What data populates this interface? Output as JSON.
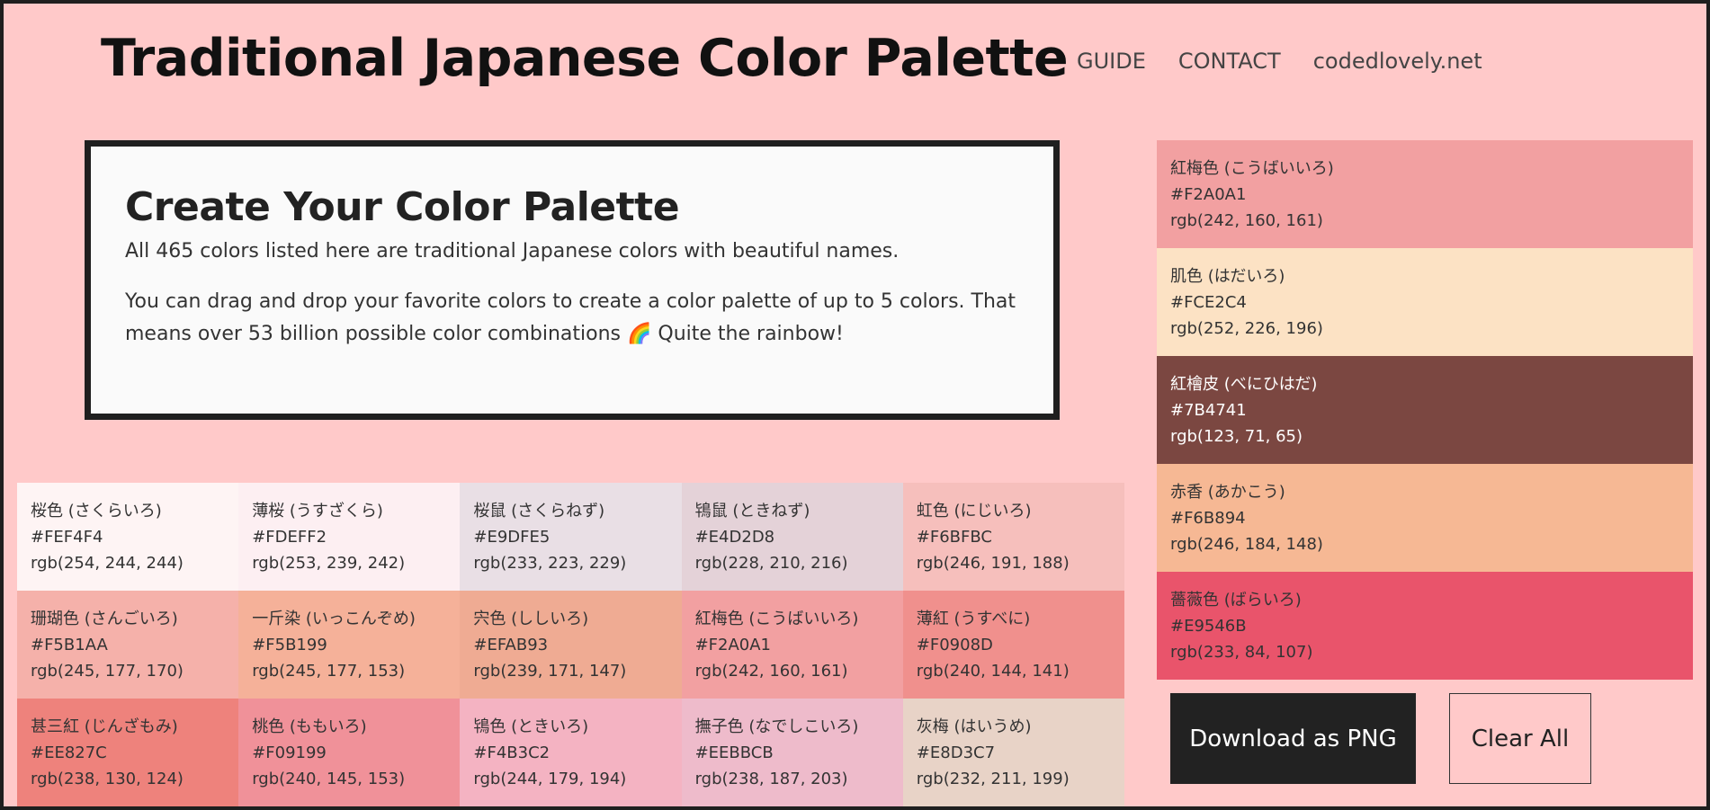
{
  "header": {
    "title": "Traditional Japanese Color Palette",
    "nav": [
      "GUIDE",
      "CONTACT",
      "codedlovely.net"
    ]
  },
  "intro": {
    "heading": "Create Your Color Palette",
    "line1": "All 465 colors listed here are traditional Japanese colors with beautiful names.",
    "line2": "You can drag and drop your favorite colors to create a color palette of up to 5 colors. That means over 53 billion possible color combinations 🌈 Quite the rainbow!"
  },
  "colors": [
    {
      "name": "桜色 (さくらいろ)",
      "hex": "#FEF4F4",
      "rgb": "rgb(254, 244, 244)",
      "text": "#333"
    },
    {
      "name": "薄桜 (うすざくら)",
      "hex": "#FDEFF2",
      "rgb": "rgb(253, 239, 242)",
      "text": "#333"
    },
    {
      "name": "桜鼠 (さくらねず)",
      "hex": "#E9DFE5",
      "rgb": "rgb(233, 223, 229)",
      "text": "#333"
    },
    {
      "name": "鴇鼠 (ときねず)",
      "hex": "#E4D2D8",
      "rgb": "rgb(228, 210, 216)",
      "text": "#333"
    },
    {
      "name": "虹色 (にじいろ)",
      "hex": "#F6BFBC",
      "rgb": "rgb(246, 191, 188)",
      "text": "#333"
    },
    {
      "name": "珊瑚色 (さんごいろ)",
      "hex": "#F5B1AA",
      "rgb": "rgb(245, 177, 170)",
      "text": "#333"
    },
    {
      "name": "一斤染 (いっこんぞめ)",
      "hex": "#F5B199",
      "rgb": "rgb(245, 177, 153)",
      "text": "#333"
    },
    {
      "name": "宍色 (ししいろ)",
      "hex": "#EFAB93",
      "rgb": "rgb(239, 171, 147)",
      "text": "#333"
    },
    {
      "name": "紅梅色 (こうばいいろ)",
      "hex": "#F2A0A1",
      "rgb": "rgb(242, 160, 161)",
      "text": "#333"
    },
    {
      "name": "薄紅 (うすべに)",
      "hex": "#F0908D",
      "rgb": "rgb(240, 144, 141)",
      "text": "#333"
    },
    {
      "name": "甚三紅 (じんざもみ)",
      "hex": "#EE827C",
      "rgb": "rgb(238, 130, 124)",
      "text": "#333"
    },
    {
      "name": "桃色 (ももいろ)",
      "hex": "#F09199",
      "rgb": "rgb(240, 145, 153)",
      "text": "#333"
    },
    {
      "name": "鴇色 (ときいろ)",
      "hex": "#F4B3C2",
      "rgb": "rgb(244, 179, 194)",
      "text": "#333"
    },
    {
      "name": "撫子色 (なでしこいろ)",
      "hex": "#EEBBCB",
      "rgb": "rgb(238, 187, 203)",
      "text": "#333"
    },
    {
      "name": "灰梅 (はいうめ)",
      "hex": "#E8D3C7",
      "rgb": "rgb(232, 211, 199)",
      "text": "#333"
    }
  ],
  "palette": [
    {
      "name": "紅梅色 (こうばいいろ)",
      "hex": "#F2A0A1",
      "rgb": "rgb(242, 160, 161)",
      "text": "#333"
    },
    {
      "name": "肌色 (はだいろ)",
      "hex": "#FCE2C4",
      "rgb": "rgb(252, 226, 196)",
      "text": "#333"
    },
    {
      "name": "紅檜皮 (べにひはだ)",
      "hex": "#7B4741",
      "rgb": "rgb(123, 71, 65)",
      "text": "#FFFFFF"
    },
    {
      "name": "赤香 (あかこう)",
      "hex": "#F6B894",
      "rgb": "rgb(246, 184, 148)",
      "text": "#333"
    },
    {
      "name": "薔薇色 (ばらいろ)",
      "hex": "#E9546B",
      "rgb": "rgb(233, 84, 107)",
      "text": "#333"
    }
  ],
  "buttons": {
    "download": "Download as PNG",
    "clear": "Clear All"
  }
}
